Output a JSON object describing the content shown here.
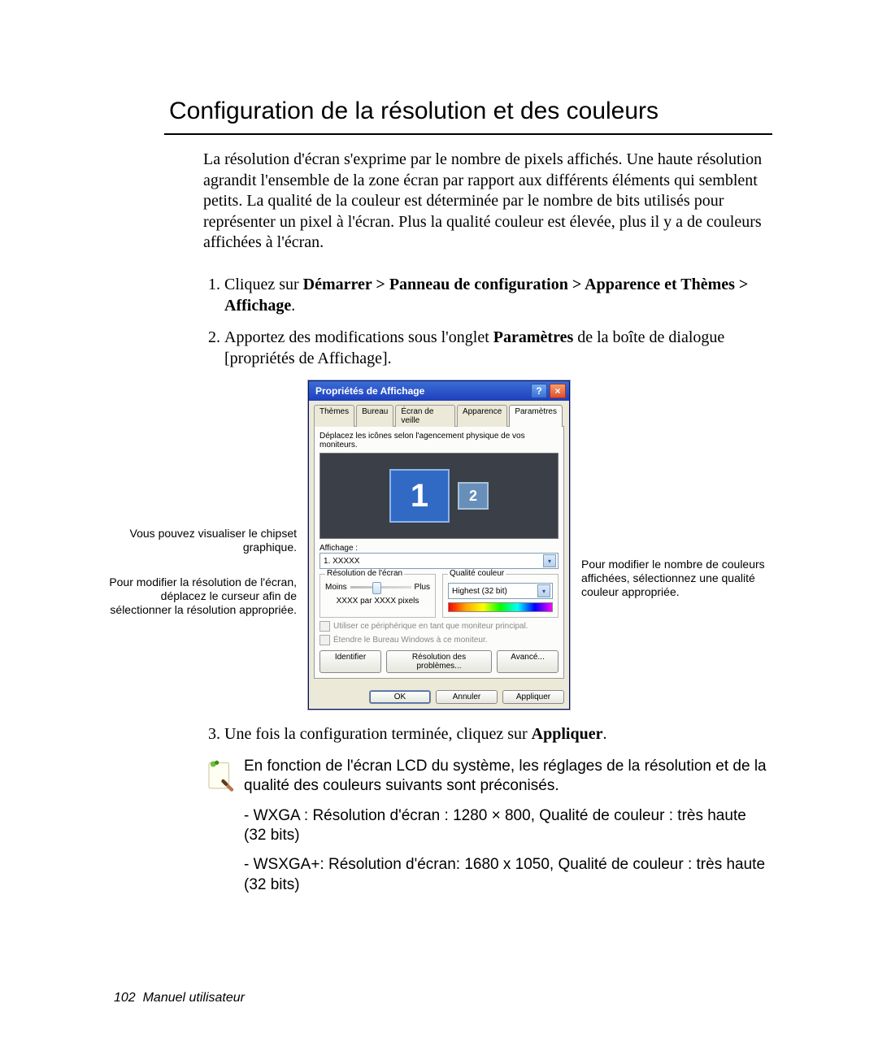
{
  "page_title": "Configuration de la résolution et des couleurs",
  "intro": "La résolution d'écran s'exprime par le nombre de pixels affichés. Une haute résolution agrandit l'ensemble de la zone écran par rapport aux différents éléments qui semblent petits. La qualité de la couleur est déterminée par le nombre de bits utilisés pour représenter un pixel à l'écran. Plus la qualité couleur est élevée, plus il y a de couleurs affichées à l'écran.",
  "steps": {
    "s1_pre": "Cliquez sur ",
    "s1_bold": "Démarrer > Panneau de configuration > Apparence et Thèmes > Affichage",
    "s1_post": ".",
    "s2_pre": "Apportez des modifications sous l'onglet ",
    "s2_bold": "Paramètres",
    "s2_post": " de la boîte de dialogue [propriétés de Affichage].",
    "s3_pre": "Une fois la configuration terminée, cliquez sur ",
    "s3_bold": "Appliquer",
    "s3_post": "."
  },
  "callouts": {
    "left1": "Vous pouvez visualiser le chipset graphique.",
    "left2": "Pour modifier la résolution de l'écran, déplacez le curseur afin de sélectionner la résolution appropriée.",
    "right1": "Pour modifier le nombre de couleurs affichées, sélectionnez une qualité couleur appropriée."
  },
  "dialog": {
    "titlebar": "Propriétés de Affichage",
    "help_glyph": "?",
    "close_glyph": "×",
    "tabs": [
      "Thèmes",
      "Bureau",
      "Écran de veille",
      "Apparence",
      "Paramètres"
    ],
    "instruction": "Déplacez les icônes selon l'agencement physique de vos moniteurs.",
    "mon1": "1",
    "mon2": "2",
    "display_label": "Affichage :",
    "display_value": "1. XXXXX",
    "res_legend": "Résolution de l'écran",
    "res_min": "Moins",
    "res_max": "Plus",
    "res_readout": "XXXX par XXXX pixels",
    "color_legend": "Qualité couleur",
    "color_value": "Highest (32 bit)",
    "chk1": "Utiliser ce périphérique en tant que moniteur principal.",
    "chk2": "Étendre le Bureau Windows à ce moniteur.",
    "btn_identify": "Identifier",
    "btn_trouble": "Résolution des problèmes...",
    "btn_advanced": "Avancé...",
    "btn_ok": "OK",
    "btn_cancel": "Annuler",
    "btn_apply": "Appliquer",
    "drop_glyph": "▾"
  },
  "note": {
    "p1": "En fonction de l'écran LCD du système, les réglages de la résolution et de la qualité des couleurs suivants sont préconisés.",
    "p2": "- WXGA : Résolution d'écran : 1280 × 800, Qualité de couleur : très haute (32 bits)",
    "p3": "- WSXGA+: Résolution d'écran: 1680 x 1050, Qualité de couleur : très haute (32 bits)"
  },
  "footer_page": "102",
  "footer_label": "Manuel utilisateur"
}
